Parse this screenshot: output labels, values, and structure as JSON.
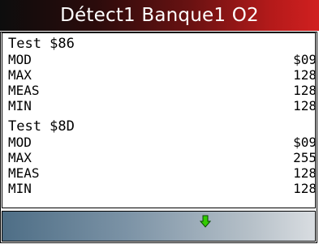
{
  "header": {
    "title": "Détect1 Banque1 O2"
  },
  "tests": [
    {
      "title": "Test $86",
      "rows": [
        {
          "label": "MOD",
          "value": "$09"
        },
        {
          "label": "MAX",
          "value": "128"
        },
        {
          "label": "MEAS",
          "value": "128"
        },
        {
          "label": "MIN",
          "value": "128"
        }
      ]
    },
    {
      "title": "Test $8D",
      "rows": [
        {
          "label": "MOD",
          "value": "$09"
        },
        {
          "label": "MAX",
          "value": "255"
        },
        {
          "label": "MEAS",
          "value": "128"
        },
        {
          "label": "MIN",
          "value": "128"
        }
      ]
    }
  ],
  "footer": {
    "scroll_icon": "down-arrow-icon",
    "icon_color": "#33cc00"
  },
  "colors": {
    "title_text": "#ffffff",
    "title_accent": "#d12020"
  }
}
